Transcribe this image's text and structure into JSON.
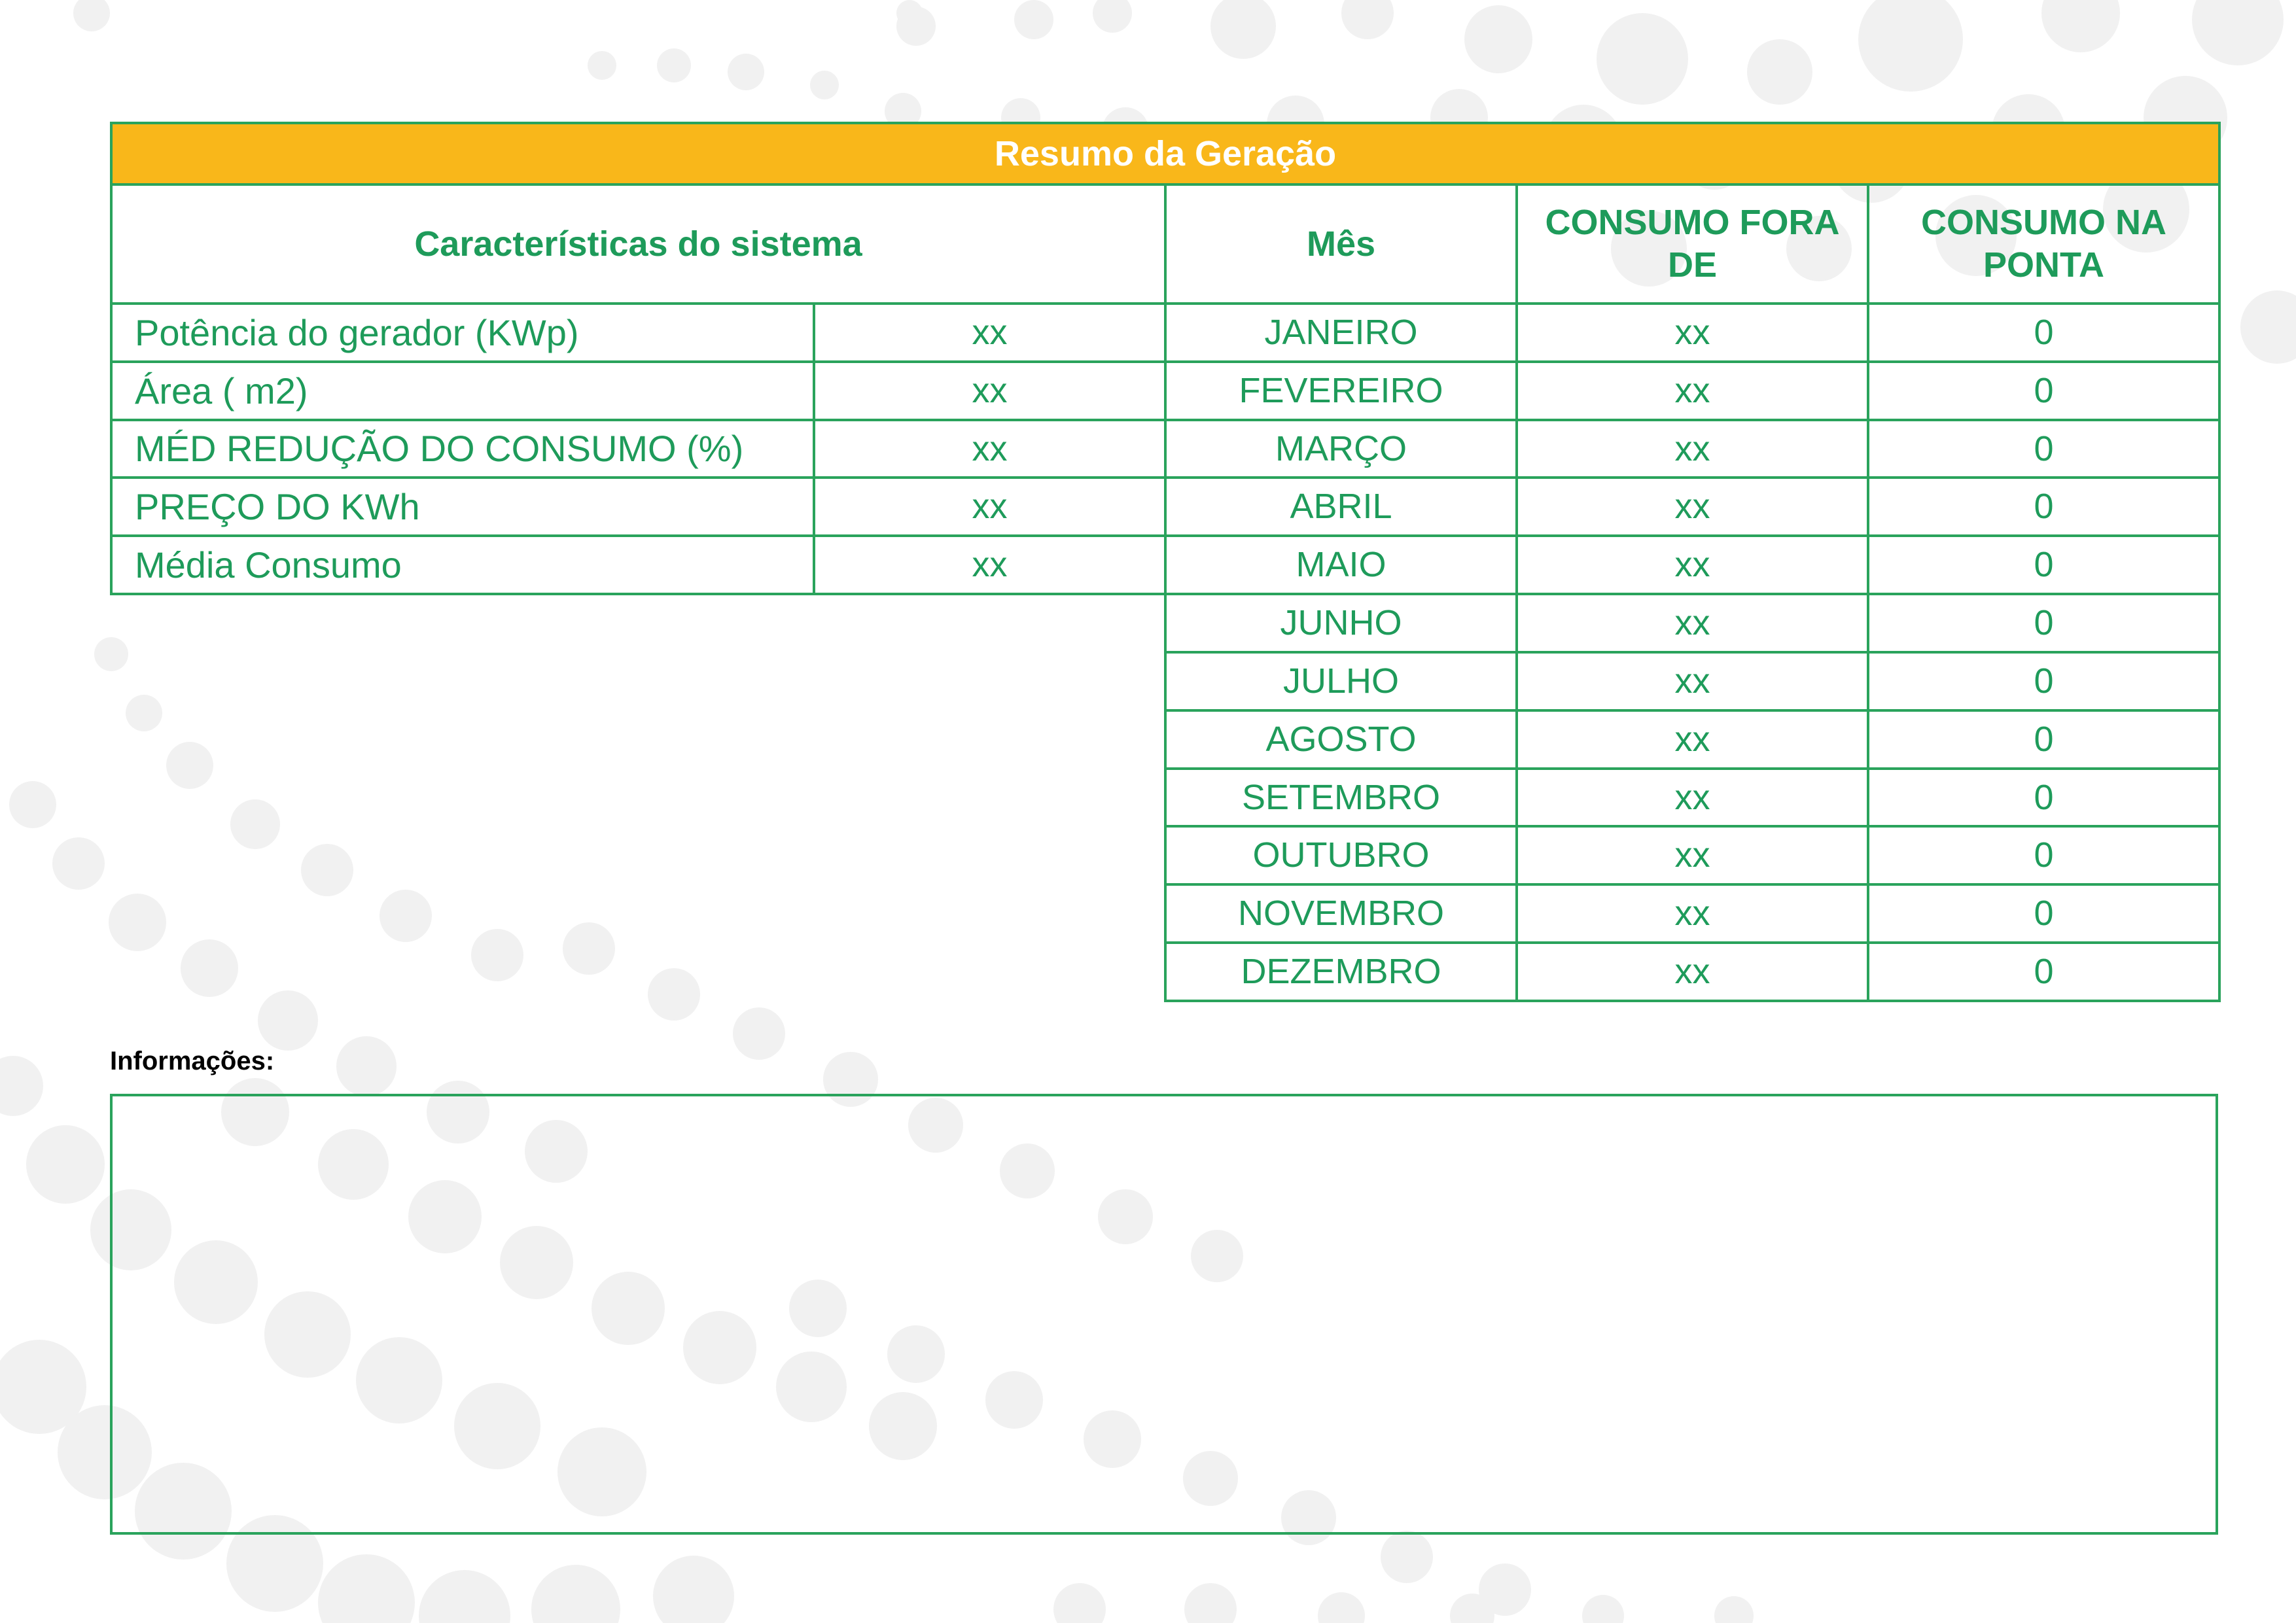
{
  "summary": {
    "title": "Resumo da Geração",
    "headers": {
      "caracteristicas": "Características do sistema",
      "mes": "Mês",
      "consumo_fora": "CONSUMO FORA DE",
      "consumo_ponta": "CONSUMO NA PONTA"
    },
    "characteristics": [
      {
        "label": "Potência do gerador (KWp)",
        "value": "xx"
      },
      {
        "label": "Área ( m2)",
        "value": "xx"
      },
      {
        "label": "MÉD REDUÇÃO DO CONSUMO (%)",
        "value": "xx"
      },
      {
        "label": "PREÇO DO KWh",
        "value": "xx"
      },
      {
        "label": "Média Consumo",
        "value": "xx"
      }
    ],
    "months": [
      {
        "name": "JANEIRO",
        "fora": "xx",
        "ponta": "0"
      },
      {
        "name": "FEVEREIRO",
        "fora": "xx",
        "ponta": "0"
      },
      {
        "name": "MARÇO",
        "fora": "xx",
        "ponta": "0"
      },
      {
        "name": "ABRIL",
        "fora": "xx",
        "ponta": "0"
      },
      {
        "name": "MAIO",
        "fora": "xx",
        "ponta": "0"
      },
      {
        "name": "JUNHO",
        "fora": "xx",
        "ponta": "0"
      },
      {
        "name": "JULHO",
        "fora": "xx",
        "ponta": "0"
      },
      {
        "name": "AGOSTO",
        "fora": "xx",
        "ponta": "0"
      },
      {
        "name": "SETEMBRO",
        "fora": "xx",
        "ponta": "0"
      },
      {
        "name": "OUTUBRO",
        "fora": "xx",
        "ponta": "0"
      },
      {
        "name": "NOVEMBRO",
        "fora": "xx",
        "ponta": "0"
      },
      {
        "name": "DEZEMBRO",
        "fora": "xx",
        "ponta": "0"
      }
    ]
  },
  "info": {
    "label": "Informações:"
  },
  "colors": {
    "accent_green": "#2aa35c",
    "text_green": "#1e9b5a",
    "title_orange": "#f9b71a",
    "dots": "#f1f1f1"
  }
}
